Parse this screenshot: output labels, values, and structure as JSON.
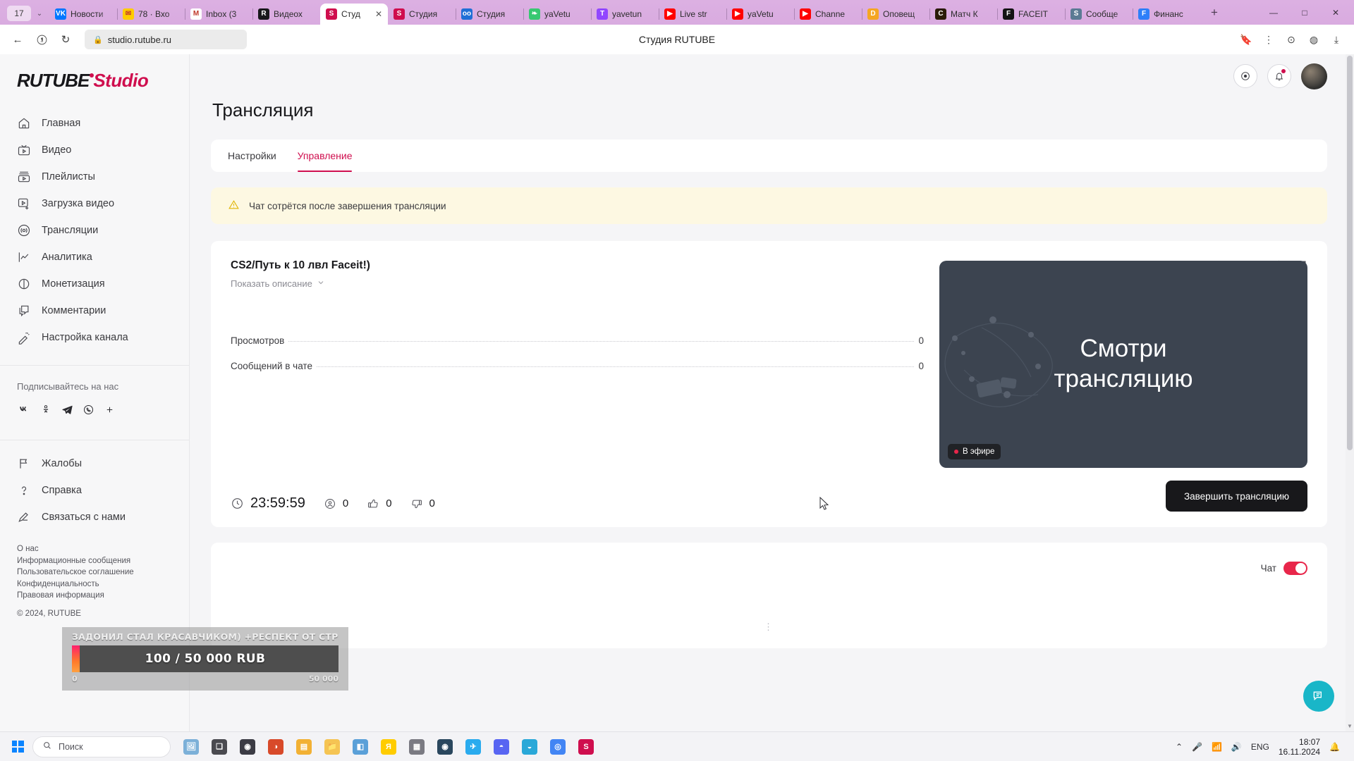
{
  "browser": {
    "tab_count": "17",
    "tabs": [
      {
        "label": "Новости",
        "icon": "vk-icon",
        "icon_text": "VK",
        "color": "#0077ff",
        "active": false
      },
      {
        "label": "78 · Вхо",
        "icon": "mail-ru-icon",
        "icon_text": "✉",
        "color": "#ffcc00",
        "active": false
      },
      {
        "label": "Inbox (3",
        "icon": "gmail-icon",
        "icon_text": "M",
        "color": "#ffffff",
        "active": false
      },
      {
        "label": "Видеох",
        "icon": "rutube-icon",
        "icon_text": "R",
        "color": "#18181b",
        "active": false
      },
      {
        "label": "Студ",
        "icon": "studio-icon",
        "icon_text": "S",
        "color": "#cf0e4e",
        "active": true
      },
      {
        "label": "Студия",
        "icon": "studio-icon",
        "icon_text": "S",
        "color": "#cf0e4e",
        "active": false
      },
      {
        "label": "Студия",
        "icon": "donationalerts-icon",
        "icon_text": "oo",
        "color": "#1f6fd6",
        "active": false
      },
      {
        "label": "yaVetu",
        "icon": "leaf-icon",
        "icon_text": "❧",
        "color": "#37c871",
        "active": false
      },
      {
        "label": "yavetun",
        "icon": "twitch-icon",
        "icon_text": "T",
        "color": "#9146ff",
        "active": false
      },
      {
        "label": "Live str",
        "icon": "youtube-icon",
        "icon_text": "▶",
        "color": "#ff0000",
        "active": false
      },
      {
        "label": "yaVetu",
        "icon": "youtube-icon",
        "icon_text": "▶",
        "color": "#ff0000",
        "active": false
      },
      {
        "label": "Channe",
        "icon": "youtube-icon",
        "icon_text": "▶",
        "color": "#ff0000",
        "active": false
      },
      {
        "label": "Оповещ",
        "icon": "donationalerts-icon",
        "icon_text": "D",
        "color": "#f5a623",
        "active": false
      },
      {
        "label": "Матч К",
        "icon": "match-icon",
        "icon_text": "C",
        "color": "#2a1a08",
        "active": false
      },
      {
        "label": "FACEIT",
        "icon": "faceit-icon",
        "icon_text": "F",
        "color": "#131313",
        "active": false
      },
      {
        "label": "Сообще",
        "icon": "steam-icon",
        "icon_text": "S",
        "color": "#5b7b94",
        "active": false
      },
      {
        "label": "Финанс",
        "icon": "f-icon",
        "icon_text": "F",
        "color": "#2d7ff9",
        "active": false
      }
    ],
    "new_tab_label": "+",
    "window_minimize": "—",
    "window_maximize": "□",
    "window_close": "✕",
    "close_tab_label": "✕",
    "url": "studio.rutube.ru",
    "page_title": "Студия RUTUBE",
    "back_label": "←",
    "forward_label": "↻",
    "yandex_label": "Я"
  },
  "sidebar": {
    "logo_main": "RUTUBE",
    "logo_accent": "Studio",
    "items": [
      {
        "label": "Главная",
        "icon": "home-icon"
      },
      {
        "label": "Видео",
        "icon": "video-icon"
      },
      {
        "label": "Плейлисты",
        "icon": "playlist-icon"
      },
      {
        "label": "Загрузка видео",
        "icon": "upload-video-icon"
      },
      {
        "label": "Трансляции",
        "icon": "broadcast-icon"
      },
      {
        "label": "Аналитика",
        "icon": "analytics-icon"
      },
      {
        "label": "Монетизация",
        "icon": "monetization-icon"
      },
      {
        "label": "Комментарии",
        "icon": "comments-icon"
      },
      {
        "label": "Настройка канала",
        "icon": "channel-settings-icon"
      }
    ],
    "follow_us_title": "Подписывайтесь на нас",
    "socials": [
      {
        "name": "vk-icon",
        "glyph": "W"
      },
      {
        "name": "odnoklassniki-icon",
        "glyph": "O"
      },
      {
        "name": "telegram-icon",
        "glyph": "➤"
      },
      {
        "name": "viber-icon",
        "glyph": "☏"
      },
      {
        "name": "more-social-icon",
        "glyph": "+"
      }
    ],
    "secondary_items": [
      {
        "label": "Жалобы",
        "icon": "flag-icon"
      },
      {
        "label": "Справка",
        "icon": "help-icon"
      },
      {
        "label": "Связаться с нами",
        "icon": "contact-us-icon"
      }
    ],
    "footer_links": [
      "О нас",
      "Информационные сообщения",
      "Пользовательское соглашение",
      "Конфиденциальность",
      "Правовая информация"
    ],
    "copyright": "© 2024, RUTUBE"
  },
  "topbar": {
    "record_icon": "record-circle-icon",
    "notifications_icon": "bell-icon",
    "avatar": "user-avatar"
  },
  "page": {
    "title": "Трансляция",
    "tabs": [
      {
        "label": "Настройки",
        "active": false
      },
      {
        "label": "Управление",
        "active": true
      }
    ],
    "alert": "Чат сотрётся после завершения трансляции"
  },
  "stream": {
    "title": "CS2/Путь к 10 лвл Faceit!)",
    "show_description": "Показать описание",
    "share_icon": "share-icon",
    "open_icon": "external-link-icon",
    "stats": [
      {
        "label": "Просмотров",
        "value": "0"
      },
      {
        "label": "Сообщений в чате",
        "value": "0"
      }
    ],
    "preview_text_line1": "Смотри",
    "preview_text_line2": "трансляцию",
    "live_badge": "В эфире",
    "timer": "23:59:59",
    "viewers": "0",
    "likes": "0",
    "dislikes": "0",
    "end_button": "Завершить трансляцию"
  },
  "chat": {
    "label": "Чат",
    "enabled": true,
    "loading": "⋮"
  },
  "donation": {
    "title": "ЗАДОНИЛ СТАЛ КРАСАВЧИКОМ) +РЕСПЕКТ ОТ СТРИМЕРА!)",
    "amount": "100 / 50 000 RUB",
    "scale_min": "0",
    "scale_max": "50 000",
    "progress_percent": 0.2
  },
  "taskbar": {
    "search_placeholder": "Поиск",
    "apps": [
      {
        "name": "gallery-app",
        "glyph": "🖼",
        "color": "#7cb0d8"
      },
      {
        "name": "task-view",
        "glyph": "❏",
        "color": "#4a4a50"
      },
      {
        "name": "obs-app",
        "glyph": "◉",
        "color": "#3b3b44"
      },
      {
        "name": "browser-app",
        "glyph": "◑",
        "color": "#d84a2a"
      },
      {
        "name": "explorer-app",
        "glyph": "▤",
        "color": "#f2b134"
      },
      {
        "name": "files-app",
        "glyph": "📁",
        "color": "#f5c453"
      },
      {
        "name": "photos-app",
        "glyph": "◧",
        "color": "#5aa0d8"
      },
      {
        "name": "yandex-app",
        "glyph": "Я",
        "color": "#ffcc00"
      },
      {
        "name": "media-app",
        "glyph": "▦",
        "color": "#7a7a82"
      },
      {
        "name": "steam-app",
        "glyph": "◉",
        "color": "#2a475e"
      },
      {
        "name": "telegram-app",
        "glyph": "✈",
        "color": "#2aabee"
      },
      {
        "name": "discord-app",
        "glyph": "◓",
        "color": "#5865f2"
      },
      {
        "name": "edge-app",
        "glyph": "◒",
        "color": "#2aa8d8"
      },
      {
        "name": "chrome-app",
        "glyph": "◎",
        "color": "#4285f4"
      },
      {
        "name": "studio-app",
        "glyph": "S",
        "color": "#cf0e4e"
      }
    ],
    "tray": {
      "chevron": "⌃",
      "mic_icon": "mic-icon",
      "network_icon": "network-icon",
      "volume_icon": "volume-icon",
      "language": "ENG",
      "time": "18:07",
      "date": "16.11.2024",
      "notifications_icon": "notification-icon"
    }
  },
  "colors": {
    "accent": "#cf0e4e",
    "live": "#e8264a",
    "tab_bar": "#d9aee0",
    "preview_bg": "#3c4450",
    "alert_bg": "#fdf8e2",
    "fab": "#19b6c8"
  }
}
